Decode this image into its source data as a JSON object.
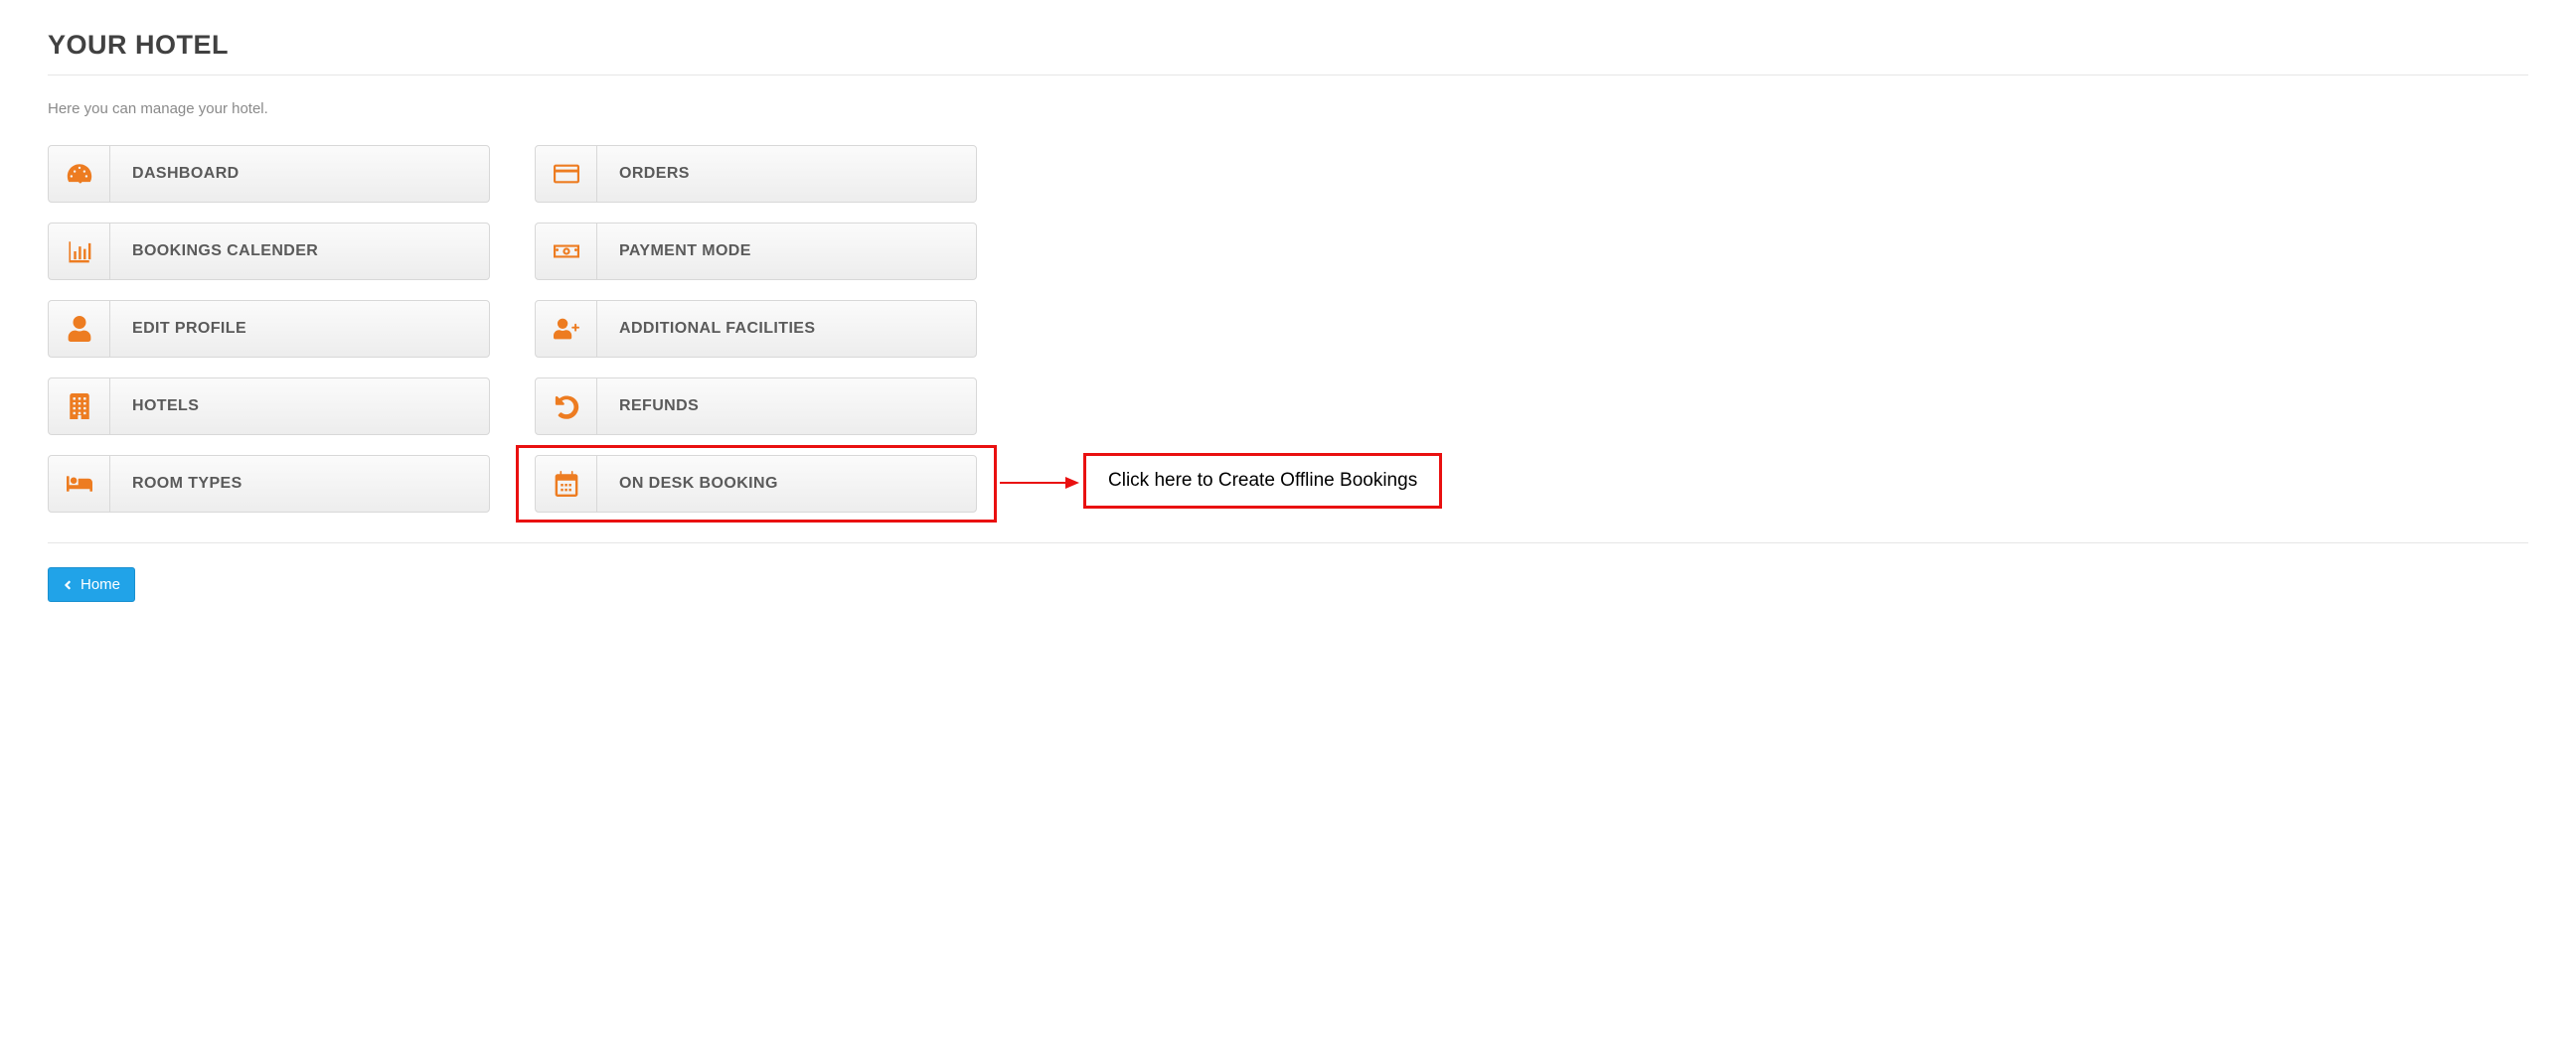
{
  "title": "YOUR HOTEL",
  "subtitle": "Here you can manage your hotel.",
  "tiles": {
    "dashboard": "DASHBOARD",
    "orders": "ORDERS",
    "bookings_calendar": "BOOKINGS CALENDER",
    "payment_mode": "PAYMENT MODE",
    "edit_profile": "EDIT PROFILE",
    "additional_facilities": "ADDITIONAL FACILITIES",
    "hotels": "HOTELS",
    "refunds": "REFUNDS",
    "room_types": "ROOM TYPES",
    "on_desk_booking": "ON DESK BOOKING"
  },
  "callout": "Click here to Create Offline Bookings",
  "home_button": "Home"
}
